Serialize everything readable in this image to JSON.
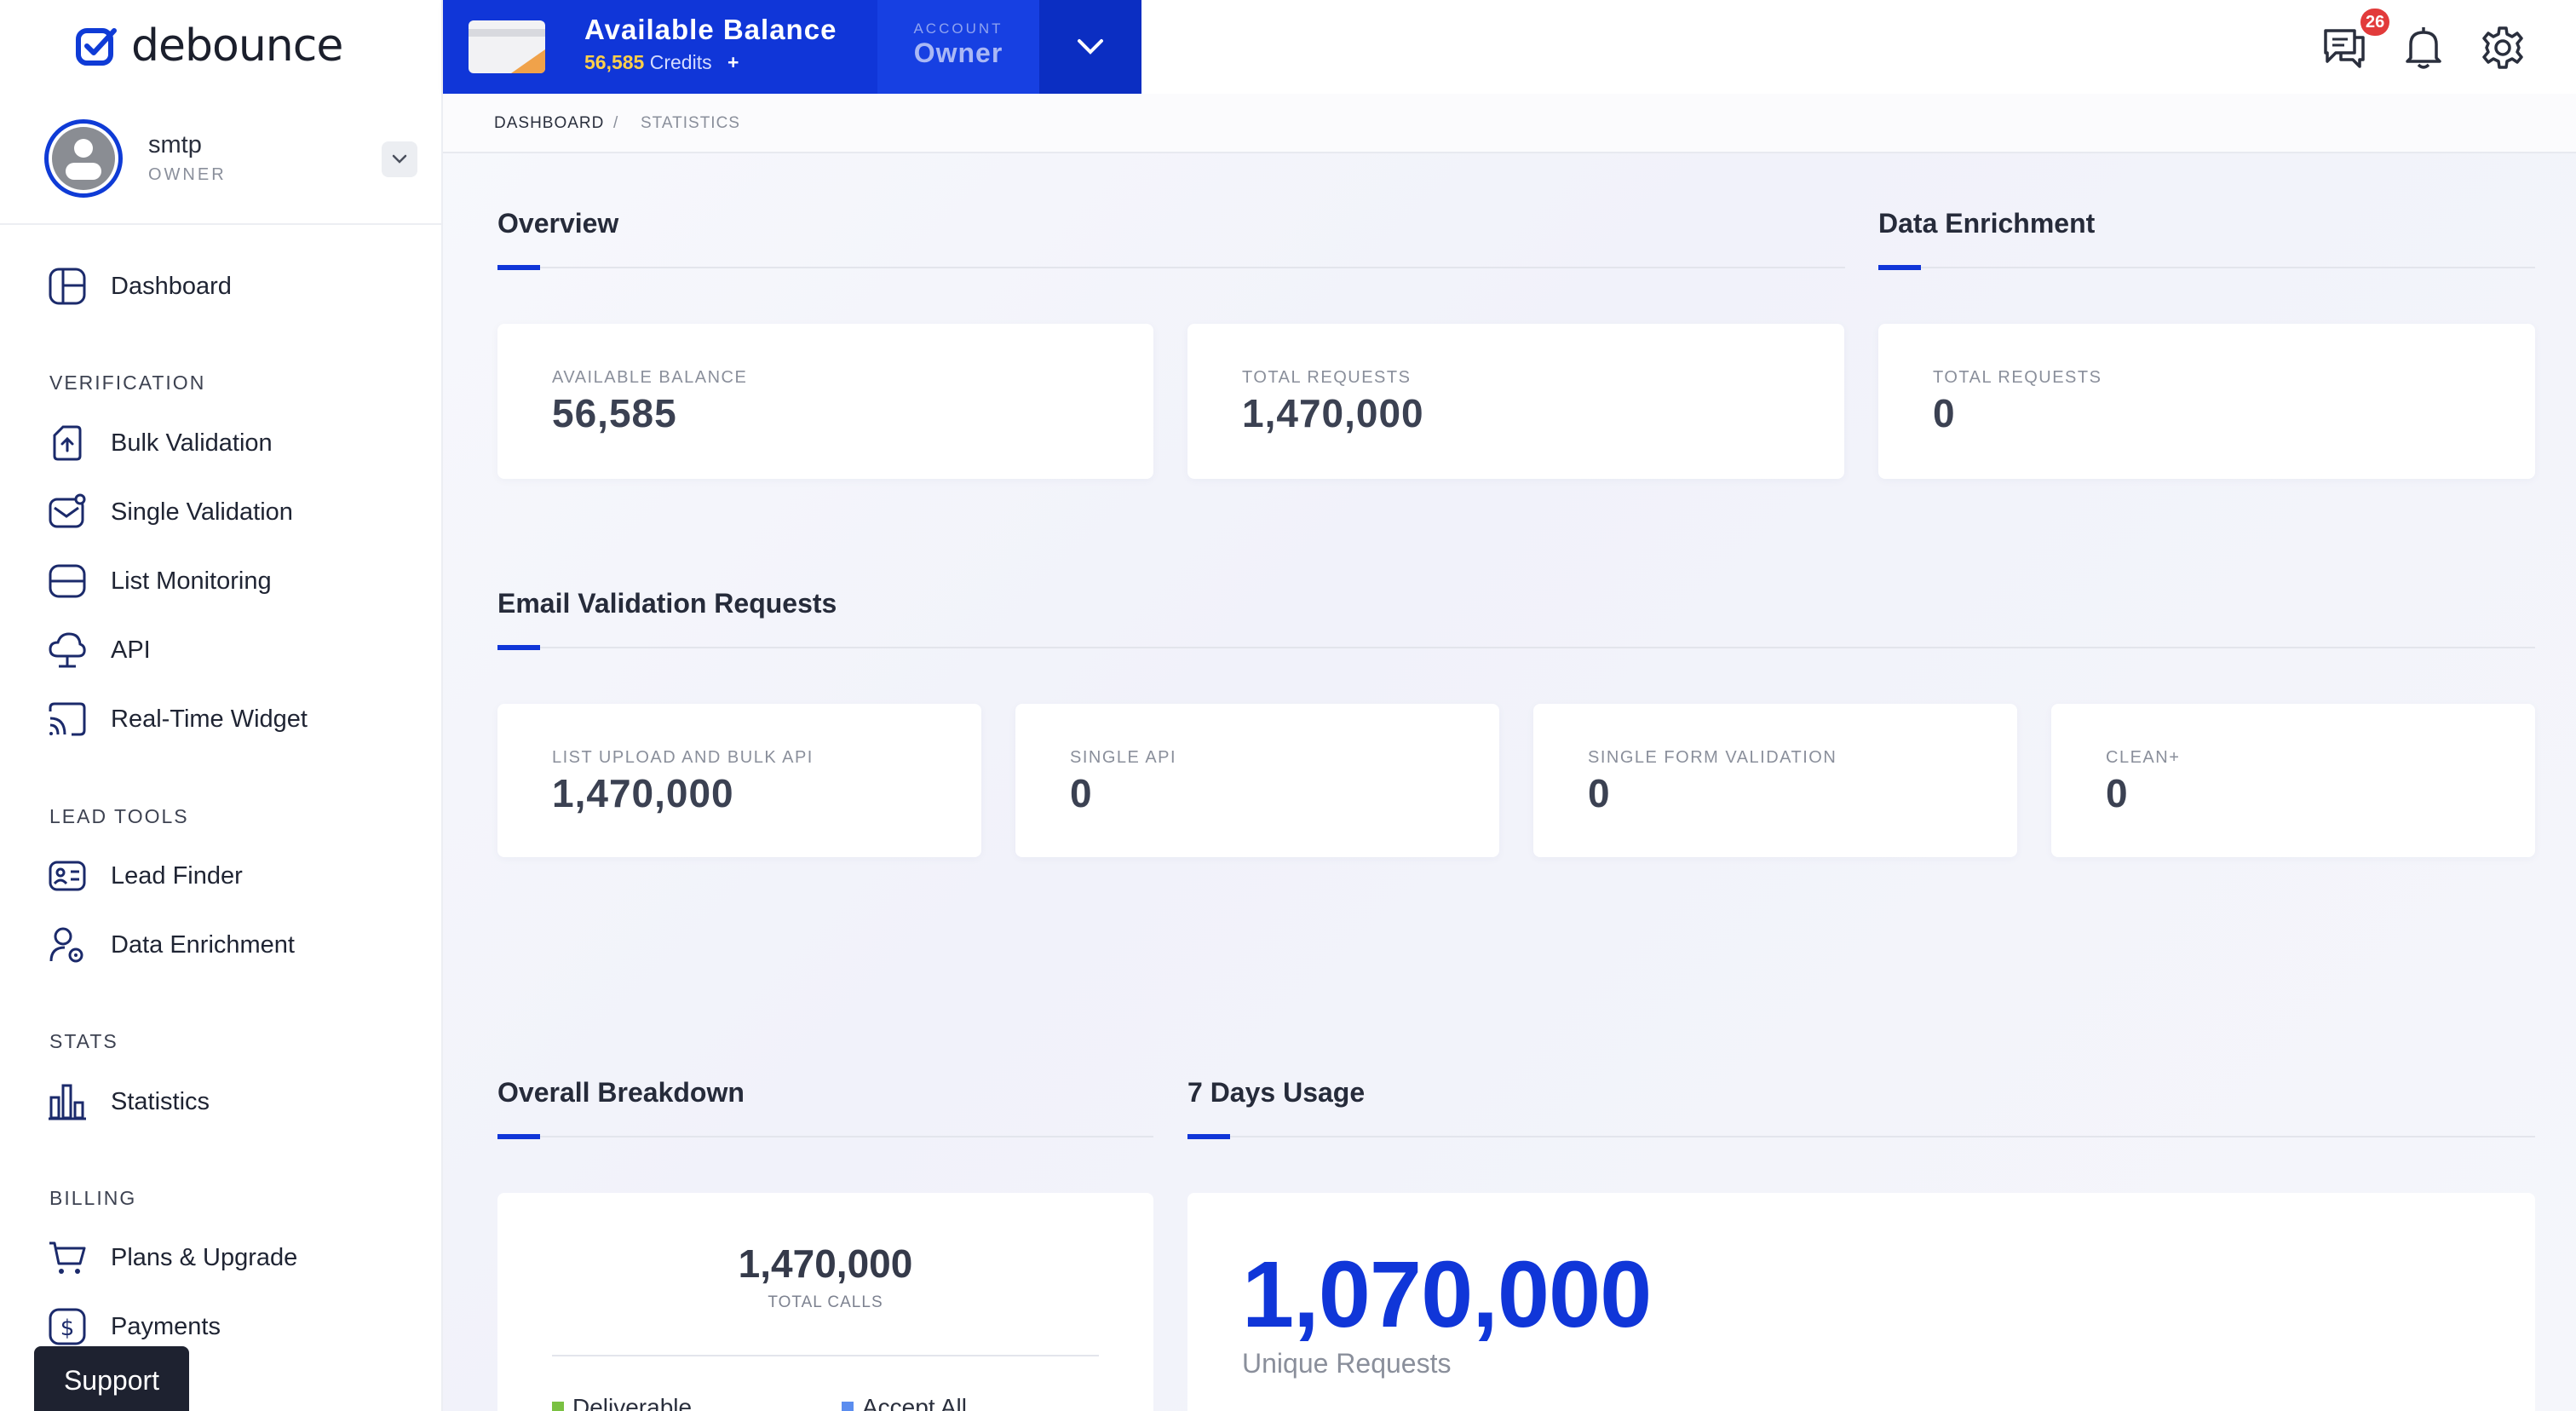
{
  "brand": {
    "name": "debounce"
  },
  "user": {
    "name": "smtp",
    "role": "OWNER"
  },
  "balance": {
    "title": "Available Balance",
    "credits_value": "56,585",
    "credits_unit": "Credits",
    "plus": "+",
    "account_label": "ACCOUNT",
    "account_value": "Owner"
  },
  "header": {
    "notifications_badge": "26"
  },
  "breadcrumb": {
    "home": "DASHBOARD",
    "separator": "/",
    "current": "STATISTICS"
  },
  "sidebar": {
    "dashboard": "Dashboard",
    "sections": {
      "verification": "VERIFICATION",
      "lead_tools": "LEAD TOOLS",
      "stats": "STATS",
      "billing": "BILLING"
    },
    "items": {
      "bulk_validation": "Bulk Validation",
      "single_validation": "Single Validation",
      "list_monitoring": "List Monitoring",
      "api": "API",
      "realtime_widget": "Real-Time Widget",
      "lead_finder": "Lead Finder",
      "data_enrichment": "Data Enrichment",
      "statistics": "Statistics",
      "plans_upgrade": "Plans & Upgrade",
      "payments": "Payments"
    },
    "support": "Support"
  },
  "overview": {
    "title": "Overview",
    "available_balance": {
      "label": "AVAILABLE BALANCE",
      "value": "56,585"
    },
    "total_requests": {
      "label": "TOTAL REQUESTS",
      "value": "1,470,000"
    }
  },
  "data_enrichment": {
    "title": "Data Enrichment",
    "total_requests": {
      "label": "TOTAL REQUESTS",
      "value": "0"
    }
  },
  "email_validation": {
    "title": "Email Validation Requests",
    "cards": [
      {
        "label": "LIST UPLOAD AND BULK API",
        "value": "1,470,000"
      },
      {
        "label": "SINGLE API",
        "value": "0"
      },
      {
        "label": "SINGLE FORM VALIDATION",
        "value": "0"
      },
      {
        "label": "CLEAN+",
        "value": "0"
      }
    ]
  },
  "breakdown": {
    "title": "Overall Breakdown",
    "total": "1,470,000",
    "total_label": "TOTAL CALLS",
    "legend": [
      {
        "label": "Deliverable",
        "color": "#7ac142"
      },
      {
        "label": "Accept All",
        "color": "#5b8def"
      }
    ]
  },
  "usage": {
    "title": "7 Days Usage",
    "value": "1,070,000",
    "label": "Unique Requests"
  },
  "colors": {
    "accent": "#1036d8",
    "dark": "#1e2230",
    "badge": "#e23b3b"
  }
}
